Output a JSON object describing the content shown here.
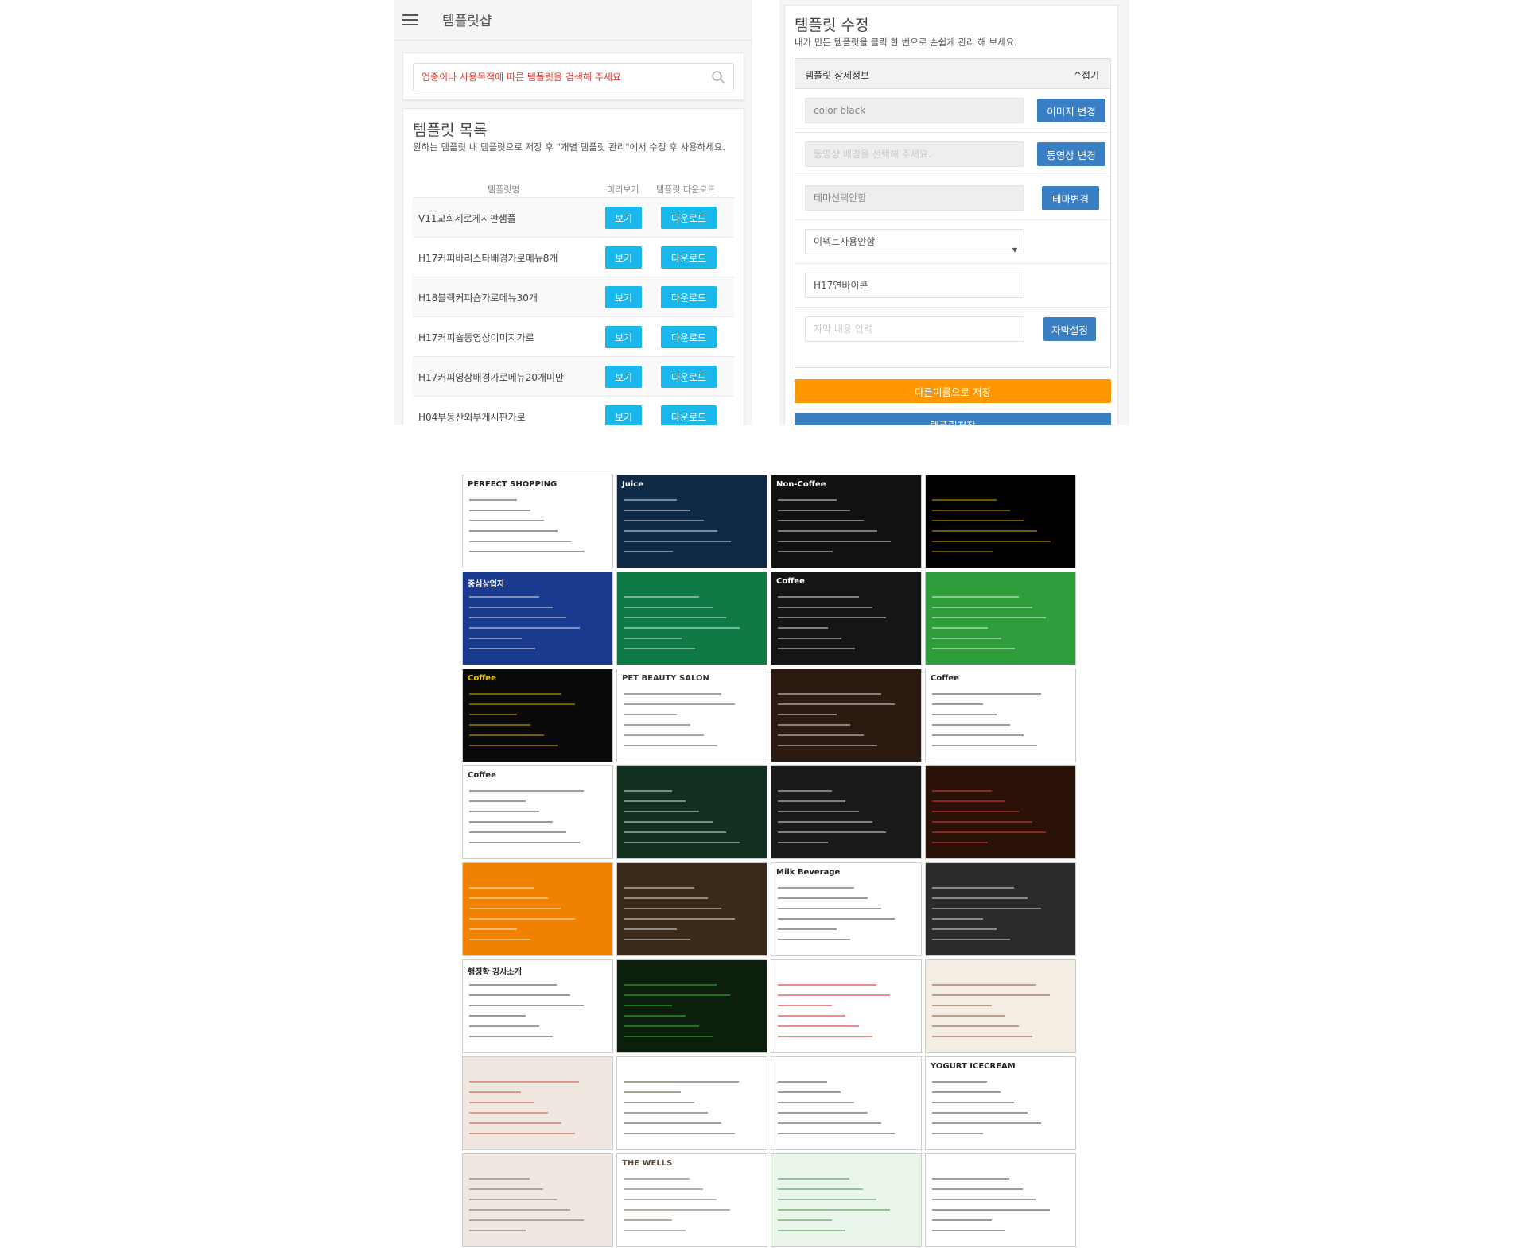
{
  "shop": {
    "title": "템플릿샵"
  },
  "search": {
    "placeholder": "업종이나 사용목적에 따른 템플릿을 검색해 주세요"
  },
  "list": {
    "title": "템플릿 목록",
    "description": "원하는 템플릿 내 템플릿으로 저장 후 \"개별 템플릿 관리\"에서 수정 후 사용하세요.",
    "headers": {
      "name": "템플릿명",
      "preview": "미리보기",
      "download": "템플릿 다운로드"
    },
    "view_label": "보기",
    "download_label": "다운로드",
    "rows": [
      "V11교회세로게시판샘플",
      "H17커피바리스타배경가로메뉴8개",
      "H18블랙커피숍가로메뉴30개",
      "H17커피숍동영상이미지가로",
      "H17커피영상배경가로메뉴20개미만",
      "H04부동산외부게시판가로"
    ]
  },
  "edit": {
    "title": "템플릿 수정",
    "description": "내가 만든 템플릿을 클릭 한 번으로 손쉽게 관리 해 보세요.",
    "detail_header": "템플릿 상세정보",
    "fold_label": "^접기",
    "image_field": "color black",
    "image_button": "이미지 변경",
    "video_placeholder": "동영상 배경을 선택해 주세요.",
    "video_button": "동영상 변경",
    "theme_field": "테마선택안함",
    "theme_button": "테마변경",
    "effect_select": "이펙트사용안함",
    "name_field": "H17연바이콘",
    "subtitle_placeholder": "자막 내용 입력",
    "subtitle_button": "자막설정",
    "save_as_button": "다른이름으로 저장",
    "save_button": "템플릿저장"
  },
  "gallery": {
    "thumbnails": [
      {
        "bg": "#ffffff",
        "fg": "#222222",
        "caption": "PERFECT SHOPPING"
      },
      {
        "bg": "#0e2a47",
        "fg": "#ffffff",
        "caption": "Juice"
      },
      {
        "bg": "#111111",
        "fg": "#ffffff",
        "caption": "Non-Coffee"
      },
      {
        "bg": "#000000",
        "fg": "#f5c400",
        "caption": ""
      },
      {
        "bg": "#1a3a8f",
        "fg": "#ffffff",
        "caption": "중심상업지"
      },
      {
        "bg": "#0f7a45",
        "fg": "#ffffff",
        "caption": ""
      },
      {
        "bg": "#151515",
        "fg": "#ffffff",
        "caption": "Coffee"
      },
      {
        "bg": "#2e9e3d",
        "fg": "#ffffff",
        "caption": ""
      },
      {
        "bg": "#0a0a0a",
        "fg": "#f5c400",
        "caption": "Coffee"
      },
      {
        "bg": "#ffffff",
        "fg": "#333333",
        "caption": "PET BEAUTY SALON"
      },
      {
        "bg": "#2a1a10",
        "fg": "#ffffff",
        "caption": ""
      },
      {
        "bg": "#ffffff",
        "fg": "#222222",
        "caption": "Coffee"
      },
      {
        "bg": "#ffffff",
        "fg": "#222222",
        "caption": "Coffee"
      },
      {
        "bg": "#123020",
        "fg": "#ffffff",
        "caption": ""
      },
      {
        "bg": "#1a1a1a",
        "fg": "#ffffff",
        "caption": ""
      },
      {
        "bg": "#2a1208",
        "fg": "#ff4444",
        "caption": ""
      },
      {
        "bg": "#f08200",
        "fg": "#ffffff",
        "caption": ""
      },
      {
        "bg": "#3b2a1a",
        "fg": "#ffffff",
        "caption": ""
      },
      {
        "bg": "#ffffff",
        "fg": "#222222",
        "caption": "Milk Beverage"
      },
      {
        "bg": "#2b2b2b",
        "fg": "#ffffff",
        "caption": ""
      },
      {
        "bg": "#ffffff",
        "fg": "#222222",
        "caption": "행정학 강사소개"
      },
      {
        "bg": "#0c1e0c",
        "fg": "#3adc3a",
        "caption": ""
      },
      {
        "bg": "#ffffff",
        "fg": "#cc0000",
        "caption": ""
      },
      {
        "bg": "#f4ede4",
        "fg": "#7a3b1a",
        "caption": ""
      },
      {
        "bg": "#f0e8e0",
        "fg": "#c0392b",
        "caption": ""
      },
      {
        "bg": "#ffffff",
        "fg": "#3a2a1a",
        "caption": ""
      },
      {
        "bg": "#ffffff",
        "fg": "#222222",
        "caption": ""
      },
      {
        "bg": "#ffffff",
        "fg": "#222222",
        "caption": "YOGURT ICECREAM"
      },
      {
        "bg": "#efe8e0",
        "fg": "#555555",
        "caption": ""
      },
      {
        "bg": "#ffffff",
        "fg": "#5a4a3a",
        "caption": "THE WELLS"
      },
      {
        "bg": "#eaf6ea",
        "fg": "#2e7d32",
        "caption": ""
      },
      {
        "bg": "#ffffff",
        "fg": "#222222",
        "caption": ""
      }
    ]
  }
}
